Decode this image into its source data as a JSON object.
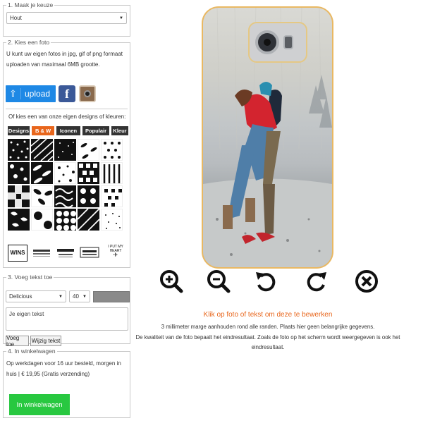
{
  "step1": {
    "legend": "1. Maak je keuze",
    "material": "Hout"
  },
  "step2": {
    "legend": "2. Kies een foto",
    "description": "U kunt uw eigen fotos in jpg, gif of png formaat uploaden van maximaal 6MB grootte.",
    "upload_label": "upload",
    "facebook_glyph": "f",
    "designs_intro": "Of kies een van onze eigen designs of kleuren:",
    "categories": [
      "Designs",
      "B & W",
      "Iconen",
      "Populair",
      "Kleur"
    ],
    "active_category": "B & W",
    "brands": [
      "WINS",
      "",
      "",
      "",
      "I PUT MY HEART"
    ]
  },
  "step3": {
    "legend": "3. Voeg tekst toe",
    "font": "Delicious",
    "font_size": "40",
    "text_color": "#8a8a8a",
    "text_placeholder": "Je eigen tekst",
    "add_text_label": "Voeg toe",
    "edit_text_label": "Wijzig tekst"
  },
  "step4": {
    "legend": "4. In winkelwagen",
    "delivery_text": "Op werkdagen voor 16 uur besteld, morgen in huis | € 19,95 (Gratis verzending)",
    "cart_button_label": "In winkelwagen"
  },
  "preview": {
    "tools": [
      "zoom-in",
      "zoom-out",
      "rotate-left",
      "rotate-right",
      "remove"
    ],
    "edit_hint": "Klik op foto of tekst om deze te bewerken",
    "margin_note": "3 millimeter marge aanhouden rond alle randen. Plaats hier geen belangrijke gegevens.",
    "quality_note": "De kwaliteit van de foto bepaalt het eindresultaat. Zoals de foto op het scherm wordt weergegeven is ook het eindresultaat."
  },
  "colors": {
    "accent": "#e8661c",
    "upload": "#1e88e5",
    "cart": "#28c840",
    "hint": "#e8661c"
  }
}
